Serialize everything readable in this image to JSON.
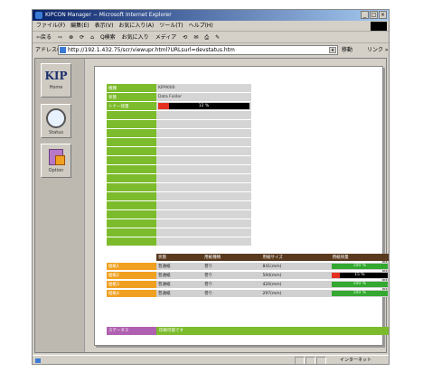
{
  "window": {
    "title": "KIPCON Manager − Microsoft Internet Explorer",
    "controls": [
      "_",
      "□",
      "×"
    ]
  },
  "menu": [
    "ファイル(F)",
    "編集(E)",
    "表示(V)",
    "お気に入り(A)",
    "ツール(T)",
    "ヘルプ(H)"
  ],
  "toolbar": [
    "⇦戻る",
    "⇨",
    "⊗",
    "⟳",
    "⌂",
    "Q検索",
    "お気に入り",
    "メディア",
    "⟲",
    "✉",
    "⎙",
    "✎"
  ],
  "address": {
    "label": "アドレス(D)",
    "url": "http://192.1.432.75/scr/viewupr.html?URLsurl=devstatus.htm",
    "go": "移動",
    "links": "リンク »"
  },
  "sidebar": {
    "kip_logo": "KIP",
    "kip_label": "Home",
    "status_label": "Status",
    "option_label": "Option"
  },
  "device": {
    "rows": [
      {
        "label": "機種",
        "value": "KIP9000"
      },
      {
        "label": "状態",
        "value": "Data Folder"
      },
      {
        "label": "トナー残量",
        "value": "12 %",
        "percent": 12
      }
    ],
    "empty_rows": 15
  },
  "drawers": {
    "headers": [
      "状態",
      "用紙種類",
      "用紙サイズ",
      "用紙残量"
    ],
    "rows": [
      {
        "name": "給紙1",
        "state": "普通紙",
        "type": "巻り",
        "size": "841(mm)",
        "remain": "100 %",
        "percent": 100
      },
      {
        "name": "給紙2",
        "state": "普通紙",
        "type": "巻り",
        "size": "594(mm)",
        "remain": "15 %",
        "percent": 15
      },
      {
        "name": "給紙3",
        "state": "普通紙",
        "type": "巻り",
        "size": "420(mm)",
        "remain": "100 %",
        "percent": 100
      },
      {
        "name": "給紙4",
        "state": "普通紙",
        "type": "巻り",
        "size": "297(mm)",
        "remain": "100 %",
        "percent": 100
      }
    ]
  },
  "status": {
    "label": "ステータス",
    "value": "印刷可能です"
  },
  "statusbar": {
    "zone": "インターネット"
  },
  "colors": {
    "green": "#7cbb2c",
    "orange": "#f0a020",
    "brown": "#5a3a1f",
    "purple": "#b060b0",
    "red": "#e53020"
  }
}
